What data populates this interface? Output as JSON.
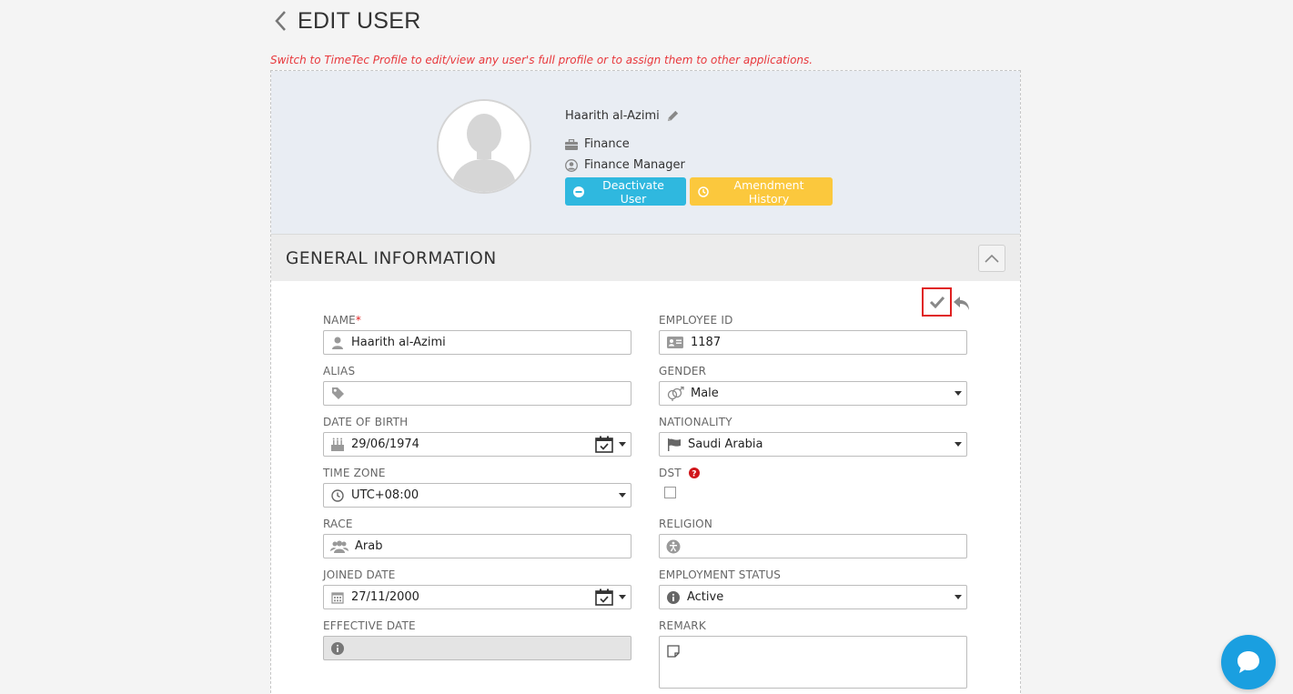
{
  "page": {
    "title": "EDIT USER",
    "notice": "Switch to TimeTec Profile to edit/view any user's full profile or to assign them to other applications."
  },
  "profile": {
    "name": "Haarith al-Azimi",
    "department": "Finance",
    "position": "Finance Manager",
    "deactivate_label": "Deactivate User",
    "amendment_label": "Amendment History"
  },
  "colors": {
    "deactivate": "#2fb8df",
    "amendment": "#fbc83d",
    "notice": "#e8373b",
    "chat": "#1a9fe0"
  },
  "section": {
    "title": "GENERAL INFORMATION"
  },
  "form": {
    "name": {
      "label": "NAME",
      "required": "*",
      "value": "Haarith al-Azimi",
      "icon": "user-icon"
    },
    "employee_id": {
      "label": "EMPLOYEE ID",
      "value": "1187",
      "icon": "id-card-icon"
    },
    "alias": {
      "label": "ALIAS",
      "value": "",
      "icon": "tag-icon"
    },
    "gender": {
      "label": "GENDER",
      "value": "Male",
      "icon": "gender-icon"
    },
    "dob": {
      "label": "DATE OF BIRTH",
      "value": "29/06/1974",
      "icon": "birthday-cake-icon"
    },
    "nationality": {
      "label": "NATIONALITY",
      "value": "Saudi Arabia",
      "icon": "flag-icon"
    },
    "timezone": {
      "label": "TIME ZONE",
      "value": "UTC+08:00",
      "icon": "clock-icon"
    },
    "dst": {
      "label": "DST",
      "checked": false
    },
    "race": {
      "label": "RACE",
      "value": "Arab",
      "icon": "users-icon"
    },
    "religion": {
      "label": "RELIGION",
      "value": "",
      "icon": "religion-icon"
    },
    "joined_date": {
      "label": "JOINED DATE",
      "value": "27/11/2000",
      "icon": "calendar-icon"
    },
    "employment_status": {
      "label": "EMPLOYMENT STATUS",
      "value": "Active",
      "icon": "info-icon"
    },
    "effective_date": {
      "label": "EFFECTIVE DATE",
      "value": "",
      "icon": "info-icon"
    },
    "remark": {
      "label": "REMARK",
      "value": "",
      "icon": "note-icon"
    }
  }
}
